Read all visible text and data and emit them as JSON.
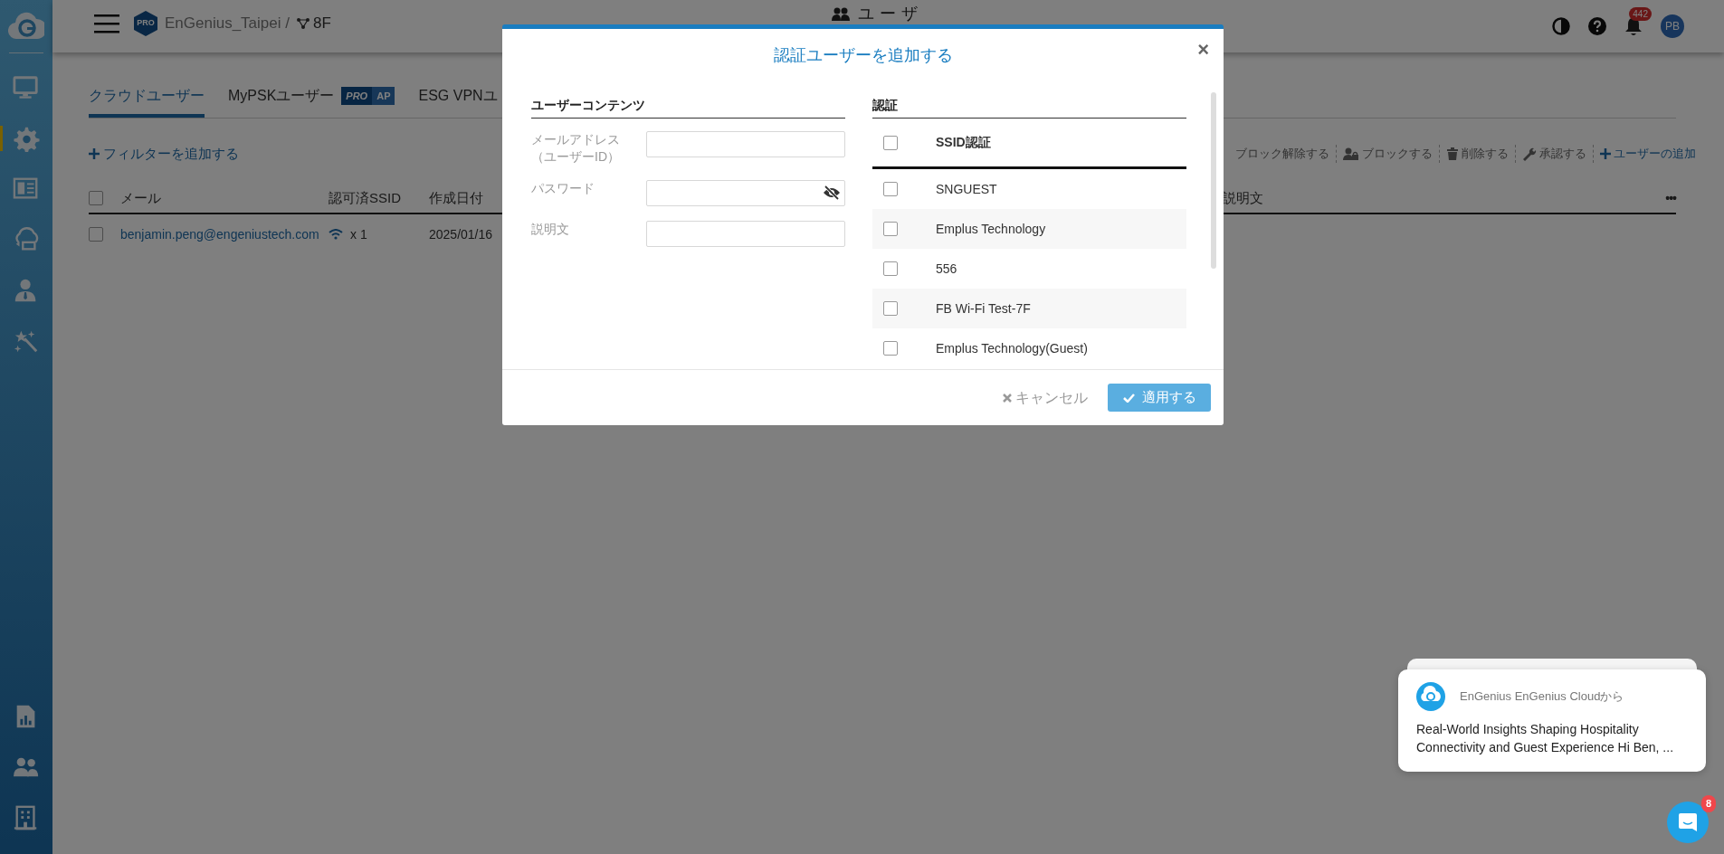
{
  "sidebar": {
    "items": [
      {
        "selected": false
      },
      {
        "selected": true
      },
      {
        "selected": false
      },
      {
        "selected": false
      },
      {
        "selected": false
      },
      {
        "selected": false
      }
    ],
    "bottom_items": [
      {
        "selected": false
      },
      {
        "selected": false
      },
      {
        "selected": false
      }
    ]
  },
  "header": {
    "site_badge": "PRO",
    "site": "EnGenius_Taipei /",
    "floor": "8F",
    "page_title": "ユーザ",
    "notification_count": "442",
    "avatar": "PB"
  },
  "tabs": [
    {
      "label": "クラウドユーザー",
      "selected": true
    },
    {
      "label": "MyPSKユーザー",
      "selected": false,
      "badges": [
        "PRO",
        "AP"
      ]
    },
    {
      "label": "ESG VPNユ",
      "selected": false
    }
  ],
  "filter_link": "フィルターを追加する",
  "toolbar": [
    {
      "label": "ブロック解除する",
      "primary": false
    },
    {
      "label": "ブロックする",
      "primary": false
    },
    {
      "label": "削除する",
      "primary": false
    },
    {
      "label": "承認する",
      "primary": false
    },
    {
      "label": "ユーザーの追加",
      "primary": true
    }
  ],
  "table": {
    "header_checked": false,
    "columns": [
      "メール",
      "認可済SSID",
      "作成日付",
      "説明文"
    ],
    "menu": "•••",
    "rows": [
      {
        "checked": false,
        "email": "benjamin.peng@engeniustech.com",
        "ssid_count": "x 1",
        "created": "2025/01/16"
      }
    ]
  },
  "modal": {
    "title": "認証ユーザーを追加する",
    "close": "×",
    "left_heading": "ユーザーコンテンツ",
    "fields": [
      {
        "label": "メールアドレス（ユーザーID）",
        "kind": "text"
      },
      {
        "label": "パスワード",
        "kind": "password"
      },
      {
        "label": "説明文",
        "kind": "text"
      }
    ],
    "right_heading": "認証",
    "ssid_header": {
      "label": "SSID認証",
      "checked": false
    },
    "ssids": [
      {
        "name": "SNGUEST",
        "checked": false
      },
      {
        "name": "Emplus Technology",
        "checked": false
      },
      {
        "name": "556",
        "checked": false
      },
      {
        "name": "FB Wi-Fi Test-7F",
        "checked": false
      },
      {
        "name": "Emplus Technology(Guest)",
        "checked": false
      }
    ],
    "cancel": "キャンセル",
    "apply": "適用する"
  },
  "notification": {
    "sender": "EnGenius EnGenius Cloudから",
    "message": "Real-World Insights Shaping Hospitality Connectivity and Guest Experience Hi Ben, ..."
  },
  "chat": {
    "badge": "8"
  }
}
